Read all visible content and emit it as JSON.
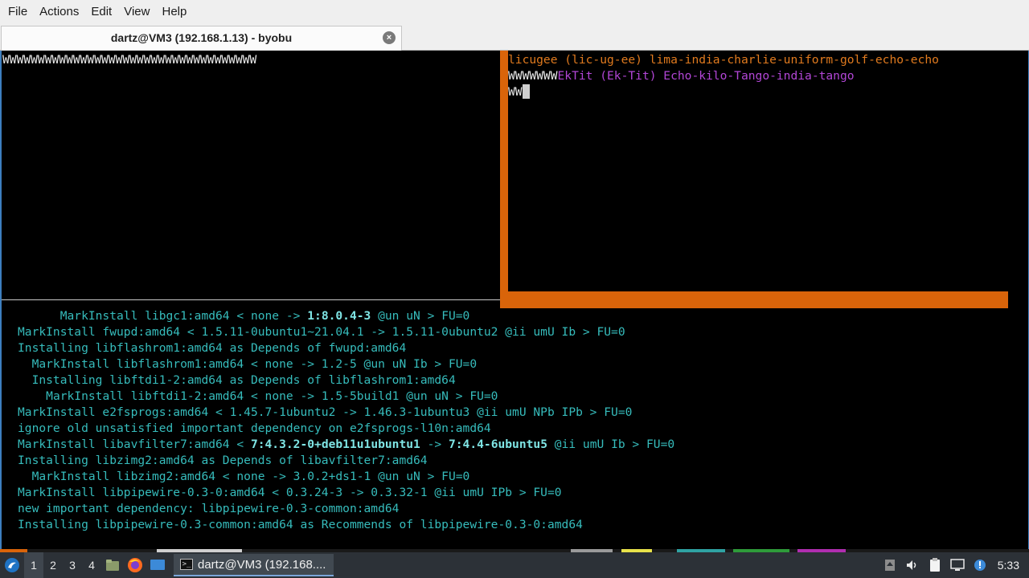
{
  "menubar": {
    "items": [
      "File",
      "Actions",
      "Edit",
      "View",
      "Help"
    ]
  },
  "tab": {
    "title": "dartz@VM3 (192.168.1.13) - byobu",
    "close_glyph": "×"
  },
  "panes": {
    "left": {
      "text": "WWWWWWWWWWWWWWWWWWWWWWWWWWWWWWWWWWWW"
    },
    "right": {
      "line1": "licugee (lic-ug-ee) lima-india-charlie-uniform-golf-echo-echo",
      "line2_prefix": "WWWWWWW",
      "line2_rest": "EkTit (Ek-Tit) Echo-kilo-Tango-india-tango",
      "line3_prefix": "WW"
    },
    "bottom": {
      "lines": [
        {
          "indent": "      ",
          "pre": "MarkInstall libgc1:amd64 < none -> ",
          "bold": "1:8.0.4-3",
          "post": " @un uN > FU=0"
        },
        {
          "indent": "",
          "pre": "MarkInstall fwupd:amd64 < 1.5.11-0ubuntu1~21.04.1 -> 1.5.11-0ubuntu2 @ii umU Ib > FU=0",
          "bold": "",
          "post": ""
        },
        {
          "indent": "",
          "pre": "Installing libflashrom1:amd64 as Depends of fwupd:amd64",
          "bold": "",
          "post": ""
        },
        {
          "indent": "  ",
          "pre": "MarkInstall libflashrom1:amd64 < none -> 1.2-5 @un uN Ib > FU=0",
          "bold": "",
          "post": ""
        },
        {
          "indent": "  ",
          "pre": "Installing libftdi1-2:amd64 as Depends of libflashrom1:amd64",
          "bold": "",
          "post": ""
        },
        {
          "indent": "    ",
          "pre": "MarkInstall libftdi1-2:amd64 < none -> 1.5-5build1 @un uN > FU=0",
          "bold": "",
          "post": ""
        },
        {
          "indent": "",
          "pre": "MarkInstall e2fsprogs:amd64 < 1.45.7-1ubuntu2 -> 1.46.3-1ubuntu3 @ii umU NPb IPb > FU=0",
          "bold": "",
          "post": ""
        },
        {
          "indent": "",
          "pre": "ignore old unsatisfied important dependency on e2fsprogs-l10n:amd64",
          "bold": "",
          "post": ""
        },
        {
          "indent": "",
          "pre": "MarkInstall libavfilter7:amd64 < ",
          "bold": "7:4.3.2-0+deb11u1ubuntu1",
          "post": " -> ",
          "bold2": "7:4.4-6ubuntu5",
          "post2": " @ii umU Ib > FU=0"
        },
        {
          "indent": "",
          "pre": "Installing libzimg2:amd64 as Depends of libavfilter7:amd64",
          "bold": "",
          "post": ""
        },
        {
          "indent": "  ",
          "pre": "MarkInstall libzimg2:amd64 < none -> 3.0.2+ds1-1 @un uN > FU=0",
          "bold": "",
          "post": ""
        },
        {
          "indent": "",
          "pre": "MarkInstall libpipewire-0.3-0:amd64 < 0.3.24-3 -> 0.3.32-1 @ii umU IPb > FU=0",
          "bold": "",
          "post": ""
        },
        {
          "indent": "",
          "pre": "new important dependency: libpipewire-0.3-common:amd64",
          "bold": "",
          "post": ""
        },
        {
          "indent": "",
          "pre": "Installing libpipewire-0.3-common:amd64 as Recommends of libpipewire-0.3-0:amd64",
          "bold": "",
          "post": ""
        }
      ]
    }
  },
  "taskbar": {
    "workspaces": [
      "1",
      "2",
      "3",
      "4"
    ],
    "active_workspace": "1",
    "task_label": "dartz@VM3 (192.168....",
    "clock": "5:33"
  },
  "colors": {
    "accent_orange": "#d9640a",
    "cyan_text": "#36bcbc",
    "purple_text": "#b246d6",
    "taskbar_bg": "#2c3137"
  }
}
